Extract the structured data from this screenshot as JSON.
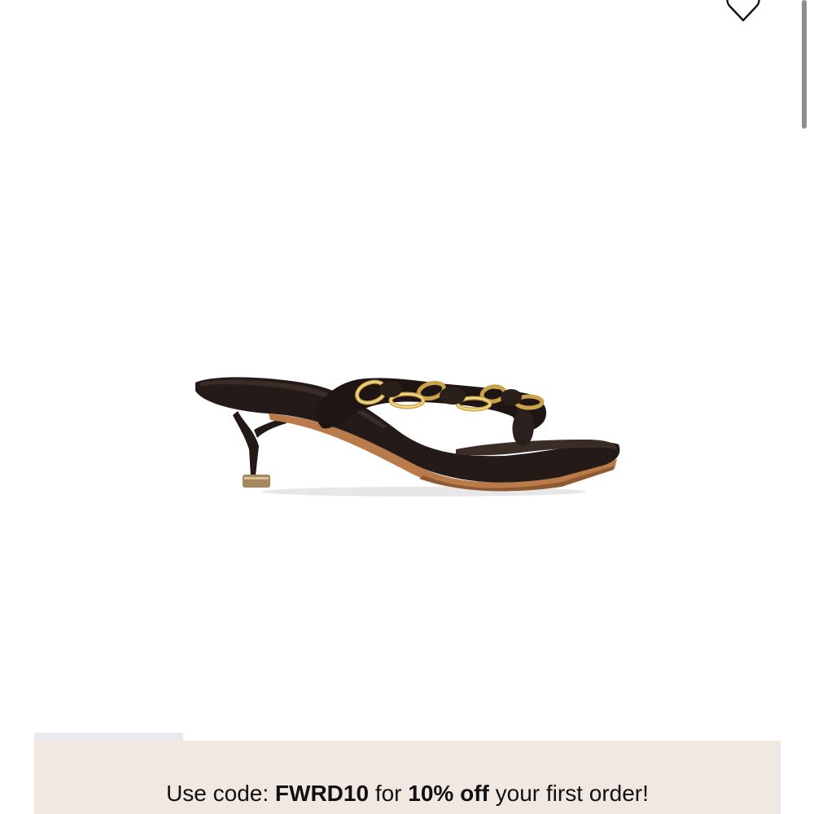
{
  "product": {
    "image_alt": "Black braided leather thong kitten-heel sandal with gold chain"
  },
  "promo": {
    "prefix": "Use code: ",
    "code": "FWRD10",
    "middle": " for ",
    "discount": "10% off",
    "suffix": " your first order!"
  },
  "icons": {
    "wishlist": "heart-icon"
  },
  "colors": {
    "banner_bg": "#f2e8e2",
    "indicator": "#e9e9ee",
    "text": "#111111"
  }
}
